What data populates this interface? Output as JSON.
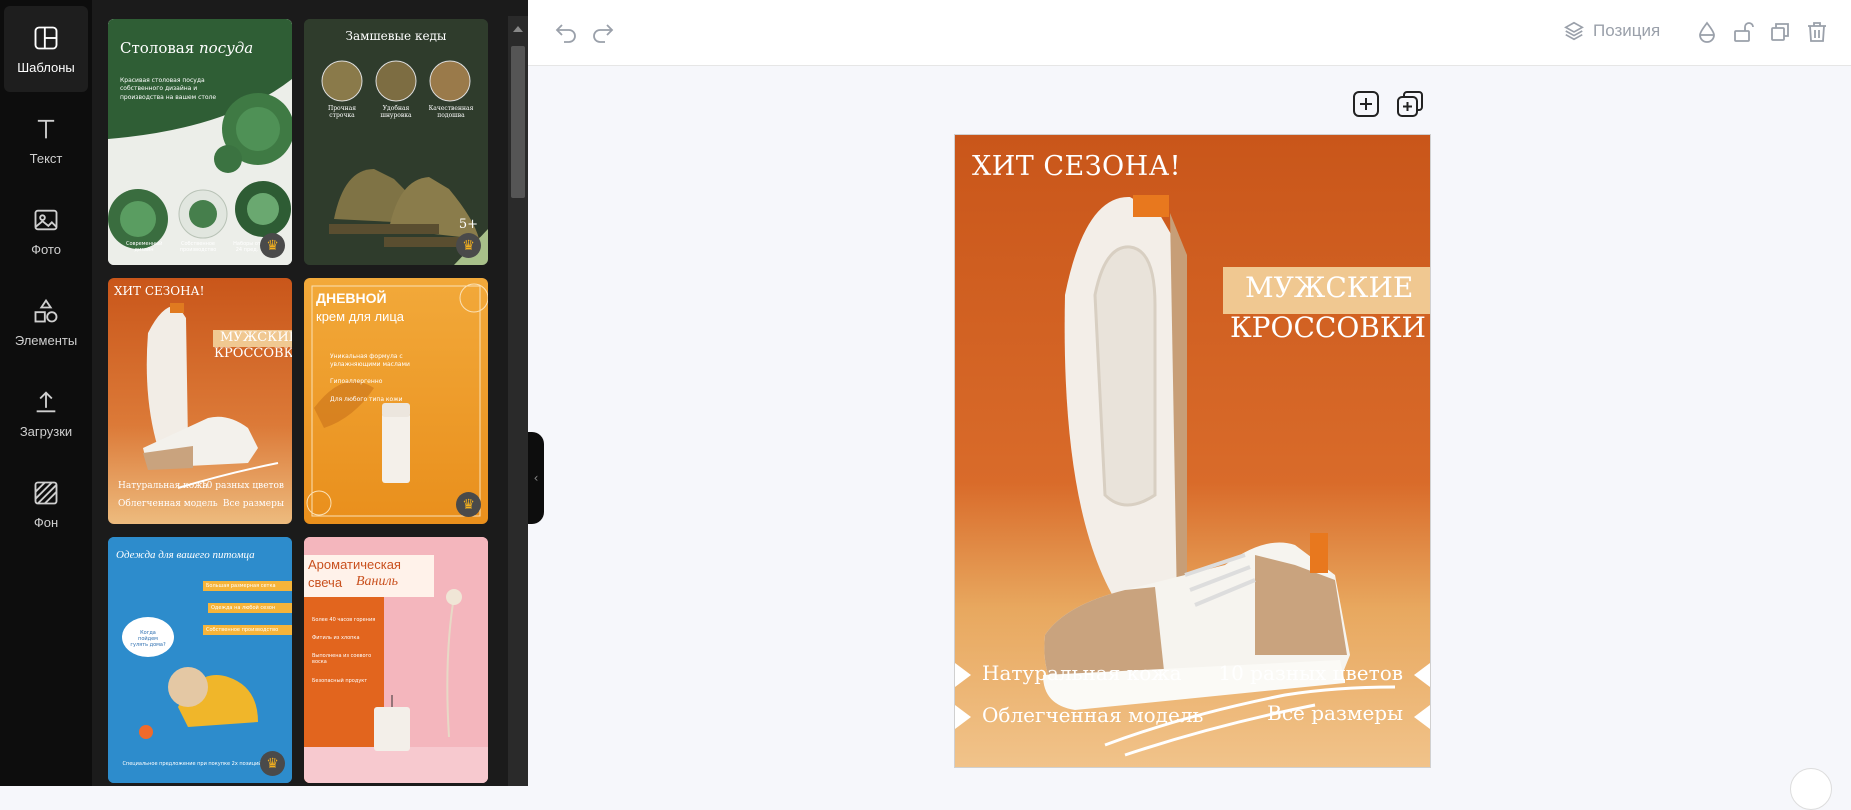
{
  "rail": {
    "items": [
      {
        "label": "Шаблоны",
        "icon": "templates-icon"
      },
      {
        "label": "Текст",
        "icon": "text-icon"
      },
      {
        "label": "Фото",
        "icon": "photo-icon"
      },
      {
        "label": "Элементы",
        "icon": "elements-icon"
      },
      {
        "label": "Загрузки",
        "icon": "uploads-icon"
      },
      {
        "label": "Фон",
        "icon": "background-icon"
      }
    ]
  },
  "templates": {
    "t1": {
      "title_a": "Столовая",
      "title_b": "посуда",
      "desc": "Красивая столовая посуда собственного дизайна и производства на вашем столе",
      "foot1": "Современный дизайн",
      "foot2": "Собственное производство",
      "foot3": "Наборы от 24 пред."
    },
    "t2": {
      "title": "Замшевые кеды",
      "c1": "Прочная строчка",
      "c2": "Удобная шнуровка",
      "c3": "Качественная подошва",
      "badge": "5+"
    },
    "t3": {
      "hit": "ХИТ СЕЗОНА!",
      "m1": "МУЖСКИЕ",
      "m2": "КРОССОВКИ",
      "f1": "Натуральная кожа",
      "f2": "10 разных цветов",
      "f3": "Облегченная модель",
      "f4": "Все размеры"
    },
    "t4": {
      "title": "ДНЕВНОЙ",
      "subtitle": "крем для лица",
      "b1": "Уникальная формула с увлажняющими маслами",
      "b2": "Гипоаллергенно",
      "b3": "Для любого типа кожи"
    },
    "t5": {
      "title": "Одежда для вашего питомца",
      "l1": "Большая размерная сетка",
      "l2": "Одежда на любой сезон",
      "l3": "Собственное производство",
      "bubble": "Когда пойдем гулять дома?",
      "footer": "Специальное предложение при покупке 2х позиций"
    },
    "t6": {
      "title_a": "Ароматическая",
      "title_b": "свеча",
      "title_c": "Ваниль",
      "l1": "Более 40 часов горения",
      "l2": "Фитиль из хлопка",
      "l3": "Выполнена из соевого воска",
      "l4": "Безопасный продукт"
    }
  },
  "toolbar": {
    "position_label": "Позиция"
  },
  "design": {
    "hit": "ХИТ СЕЗОНА!",
    "title1": "МУЖСКИЕ",
    "title2": "КРОССОВКИ",
    "f1": "Натуральная кожа",
    "f2": "10 разных цветов",
    "f3": "Облегченная модель",
    "f4": "Все размеры"
  }
}
